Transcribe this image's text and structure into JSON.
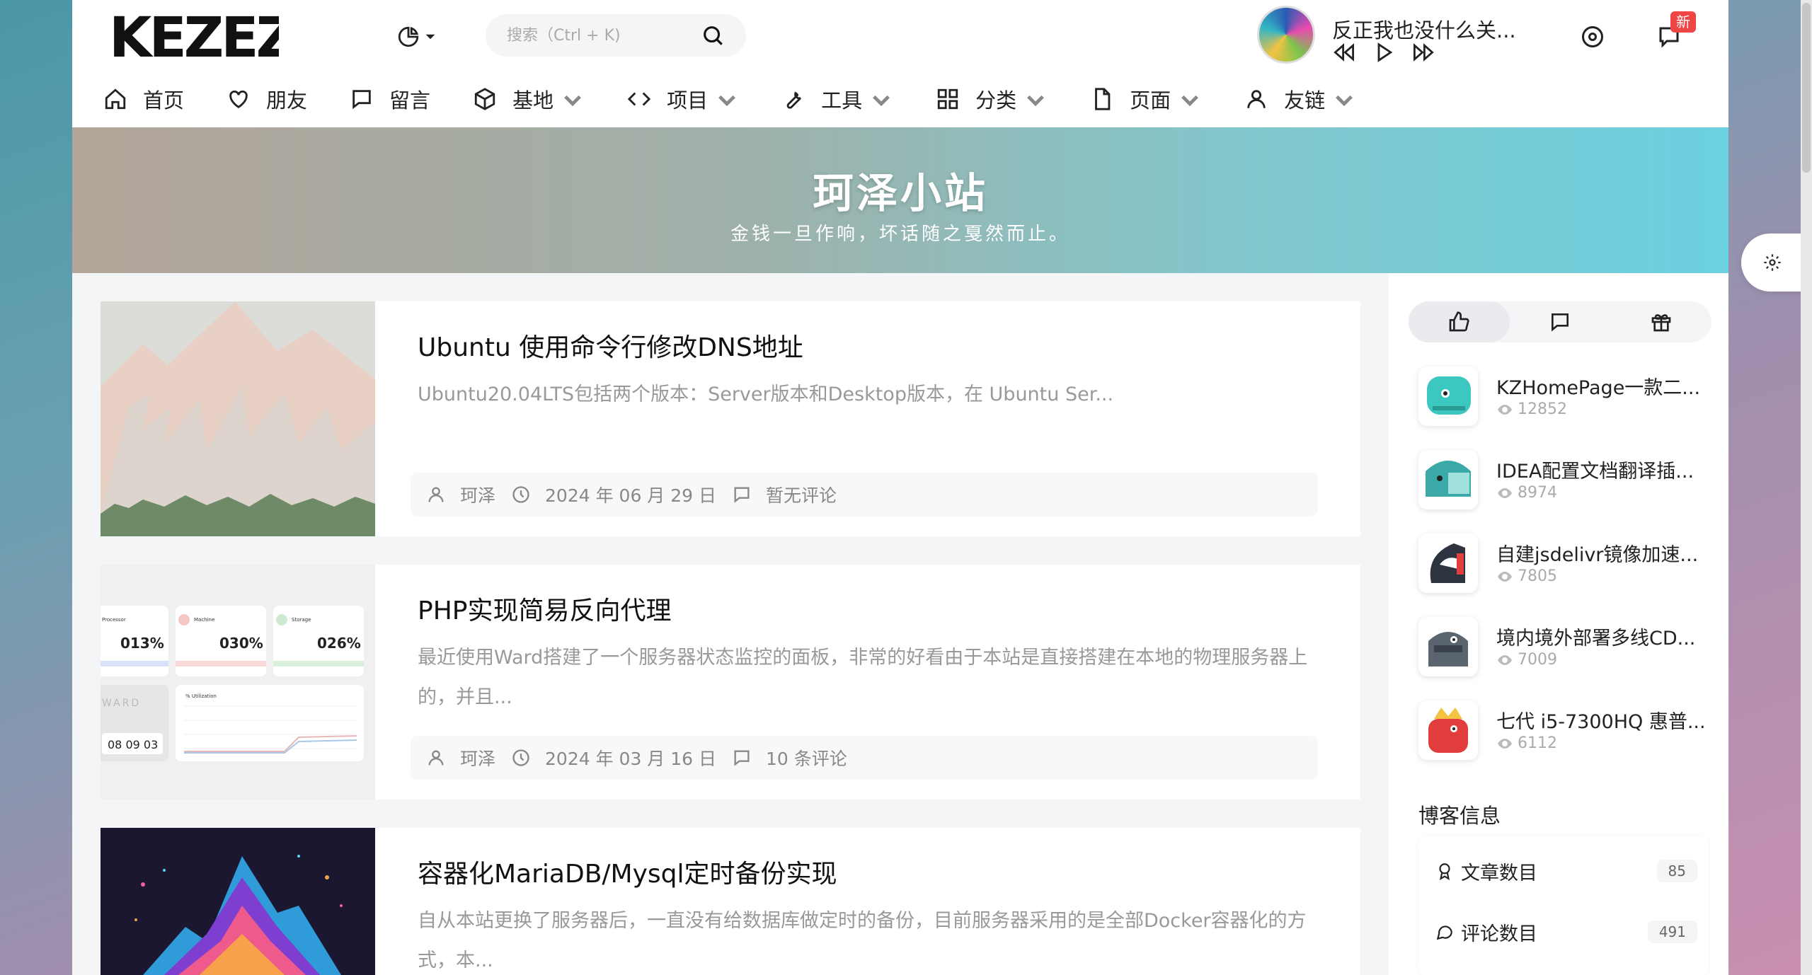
{
  "header": {
    "logo_text": "KEZEZ",
    "search_placeholder": "搜索（Ctrl + K)",
    "player": {
      "song_title": "反正我也没什么关..."
    },
    "new_badge": "新"
  },
  "nav": [
    {
      "label": "首页",
      "icon": "home-icon",
      "dropdown": false
    },
    {
      "label": "朋友",
      "icon": "heart-icon",
      "dropdown": false
    },
    {
      "label": "留言",
      "icon": "message-icon",
      "dropdown": false
    },
    {
      "label": "基地",
      "icon": "cube-icon",
      "dropdown": true
    },
    {
      "label": "项目",
      "icon": "code-icon",
      "dropdown": true
    },
    {
      "label": "工具",
      "icon": "wrench-icon",
      "dropdown": true
    },
    {
      "label": "分类",
      "icon": "grid-icon",
      "dropdown": true
    },
    {
      "label": "页面",
      "icon": "file-icon",
      "dropdown": true
    },
    {
      "label": "友链",
      "icon": "user-icon",
      "dropdown": true
    }
  ],
  "banner": {
    "title": "珂泽小站",
    "motto": "金钱一旦作响，坏话随之戛然而止。"
  },
  "posts": [
    {
      "title": "Ubuntu 使用命令行修改DNS地址",
      "excerpt": "Ubuntu20.04LTS包括两个版本：Server版本和Desktop版本，在 Ubuntu Ser...",
      "author": "珂泽",
      "date": "2024 年 06 月 29 日",
      "comments": "暂无评论"
    },
    {
      "title": "PHP实现简易反向代理",
      "excerpt": "最近使用Ward搭建了一个服务器状态监控的面板，非常的好看由于本站是直接搭建在本地的物理服务器上的，并且...",
      "author": "珂泽",
      "date": "2024 年 03 月 16 日",
      "comments": "10 条评论",
      "thumb": {
        "cards": [
          {
            "label": "Processor",
            "value": "013%"
          },
          {
            "label": "Machine",
            "value": "030%"
          },
          {
            "label": "Storage",
            "value": "026%"
          }
        ],
        "brand": "WARD",
        "clock": "08 09 03",
        "chart_label": "% Utilization"
      }
    },
    {
      "title": "容器化MariaDB/Mysql定时备份实现",
      "excerpt": "自从本站更换了服务器后，一直没有给数据库做定时的备份，目前服务器采用的是全部Docker容器化的方式，本...",
      "author": "",
      "date": "",
      "comments": ""
    }
  ],
  "sidebar": {
    "tabs": [
      "thumbs-up-icon",
      "comment-icon",
      "gift-icon"
    ],
    "hot": [
      {
        "title": "KZHomePage一款二...",
        "views": "12852",
        "color": "#3cc8c0"
      },
      {
        "title": "IDEA配置文档翻译插...",
        "views": "8974",
        "color": "#3aa9a8"
      },
      {
        "title": "自建jsdelivr镜像加速...",
        "views": "7805",
        "color": "#2d3440"
      },
      {
        "title": "境内境外部署多线CD...",
        "views": "7009",
        "color": "#5a6570"
      },
      {
        "title": "七代 i5-7300HQ 惠普...",
        "views": "6112",
        "color": "#e23d3d"
      }
    ],
    "blog_info_heading": "博客信息",
    "blog_info": [
      {
        "label": "文章数目",
        "count": "85",
        "icon": "award-icon"
      },
      {
        "label": "评论数目",
        "count": "491",
        "icon": "comment-icon"
      }
    ]
  }
}
